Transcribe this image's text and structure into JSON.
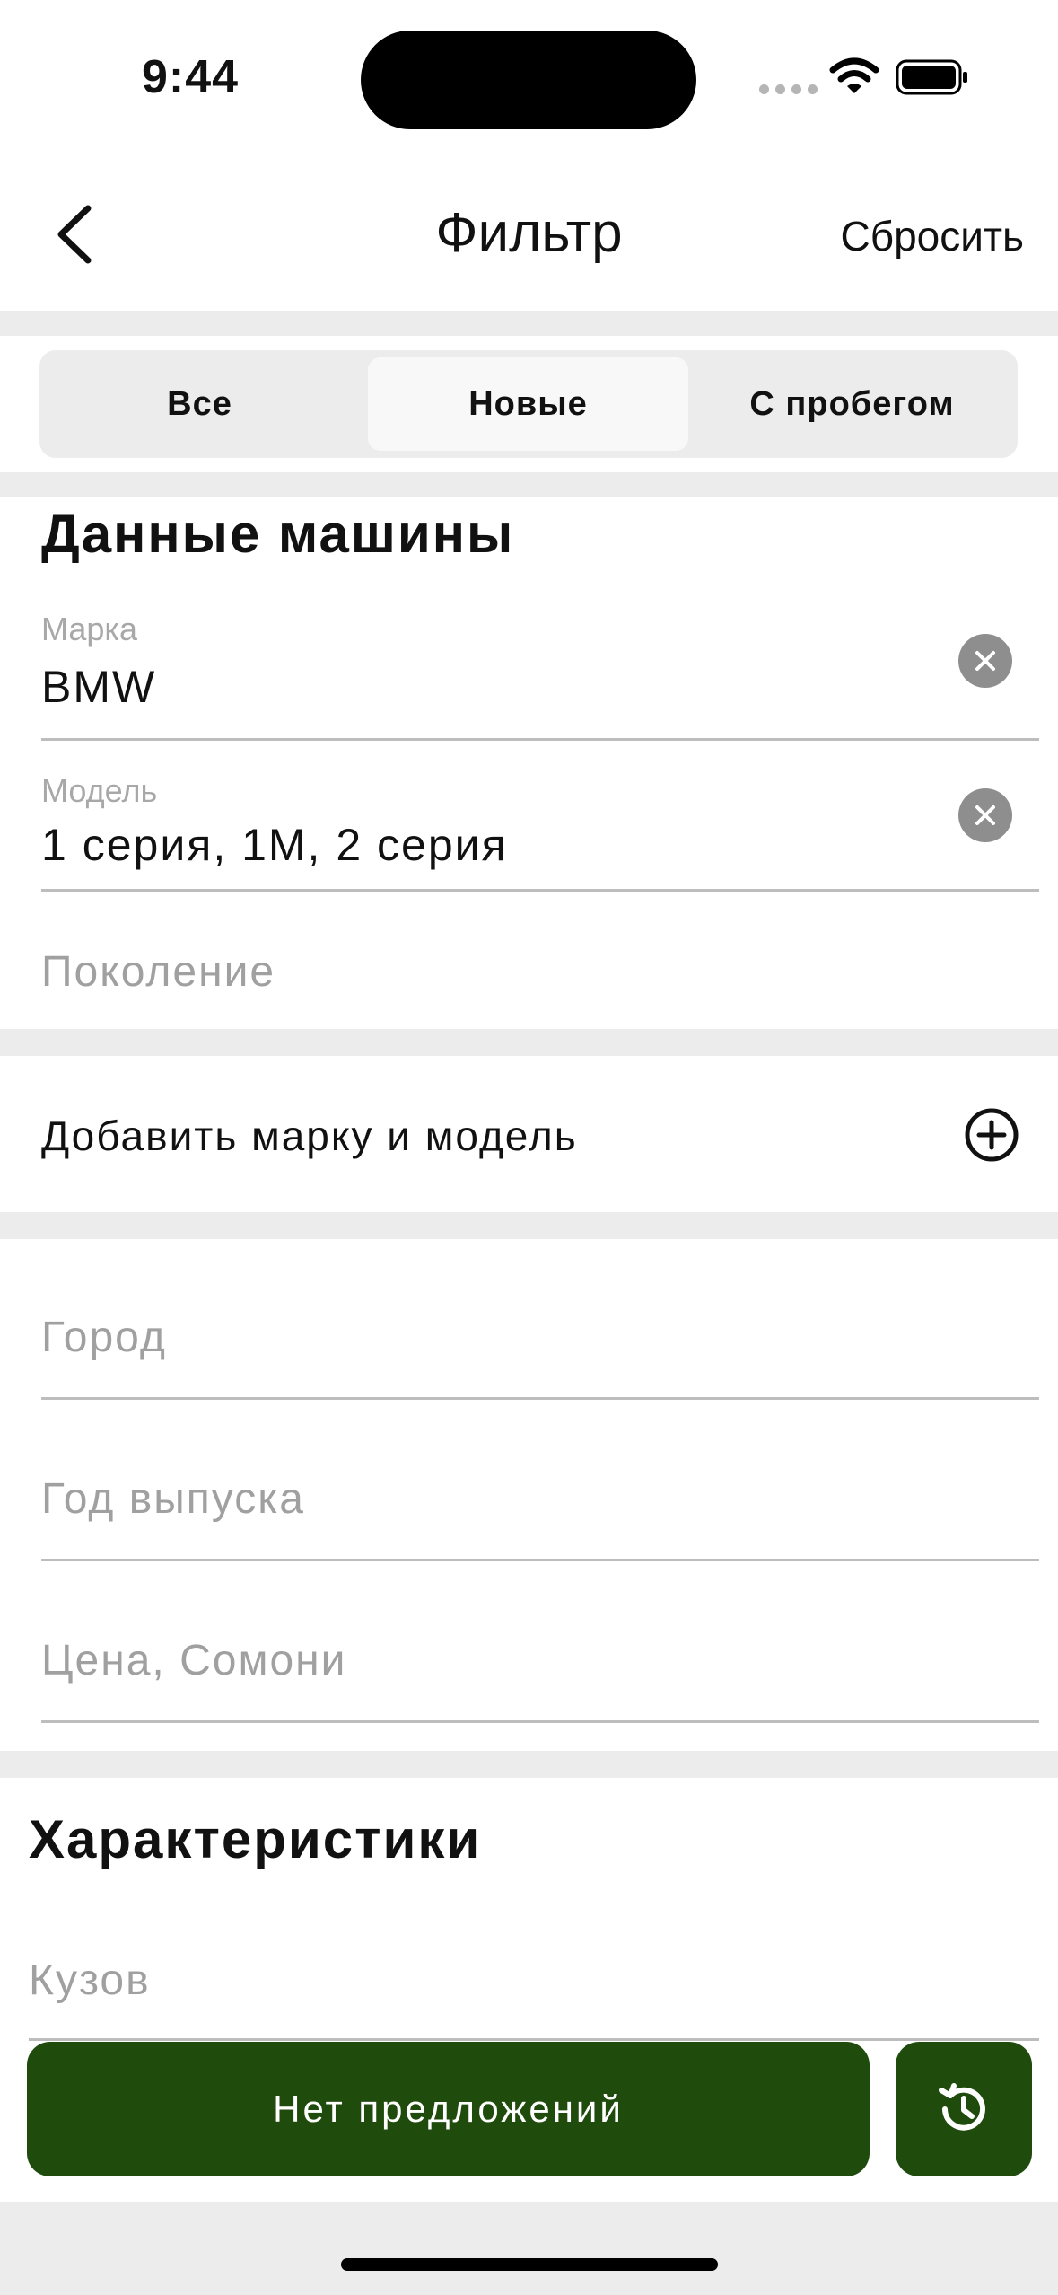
{
  "status_bar": {
    "time": "9:44"
  },
  "nav": {
    "title": "Фильтр",
    "reset_label": "Сбросить"
  },
  "segments": {
    "all": "Все",
    "new": "Новые",
    "used": "С пробегом",
    "selected": "Новые"
  },
  "car_section": {
    "title": "Данные машины",
    "brand": {
      "label": "Марка",
      "value": "BMW"
    },
    "model": {
      "label": "Модель",
      "value": "1 серия, 1M, 2 серия"
    },
    "generation_placeholder": "Поколение"
  },
  "add_brand_label": "Добавить марку и модель",
  "location_section": {
    "city_placeholder": "Город",
    "year_placeholder": "Год выпуска",
    "price_placeholder": "Цена, Сомони"
  },
  "specs_section": {
    "title": "Характеристики",
    "body_placeholder": "Кузов"
  },
  "bottom": {
    "primary_label": "Нет предложений"
  },
  "colors": {
    "accent": "#1f4b0c",
    "band": "#ececec"
  },
  "icons": [
    "chevron-left-icon",
    "wifi-icon",
    "battery-icon",
    "clear-icon",
    "plus-circle-icon",
    "history-icon"
  ]
}
